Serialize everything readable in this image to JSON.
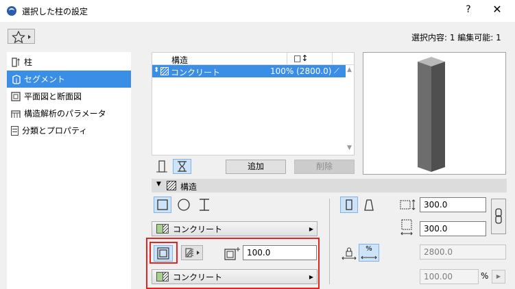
{
  "window": {
    "title": "選択した柱の設定",
    "help": "?",
    "close": "✕"
  },
  "toolbar": {
    "favorites_icon": "star-icon",
    "selection_info": "選択内容: 1 編集可能: 1"
  },
  "sidebar": {
    "items": [
      {
        "label": "柱",
        "icon": "column-icon",
        "selected": false
      },
      {
        "label": "セグメント",
        "icon": "segment-icon",
        "selected": true
      },
      {
        "label": "平面図と断面図",
        "icon": "floor-plan-icon",
        "selected": false
      },
      {
        "label": "構造解析のパラメータ",
        "icon": "structural-analysis-icon",
        "selected": false
      },
      {
        "label": "分類とプロパティ",
        "icon": "document-icon",
        "selected": false
      }
    ]
  },
  "segments_table": {
    "columns": [
      "構造",
      "□↕"
    ],
    "rows": [
      {
        "structure": "コンクリート",
        "value": "100% (2800.0)"
      }
    ]
  },
  "segment_buttons": {
    "add": "追加",
    "delete": "削除"
  },
  "structure_section": {
    "title": "構造",
    "material": "コンクリート",
    "core_material": "コンクリート",
    "thickness": "100.0",
    "width": "300.0",
    "depth": "300.0",
    "length": "2800.0",
    "percent": "100.00",
    "percent_unit": "%",
    "percent_toggle": "%"
  },
  "colors": {
    "selection": "#3a8ee6",
    "highlight_frame": "#e52421",
    "toggle_bg": "#cde3f7"
  }
}
